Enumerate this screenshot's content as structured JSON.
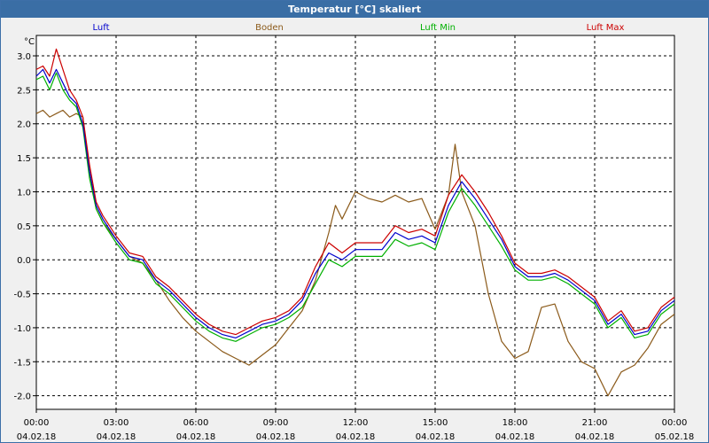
{
  "window": {
    "title": "Temperatur [°C] skaliert"
  },
  "chart_data": {
    "type": "line",
    "title": "Temperatur [°C] skaliert",
    "ylabel": "°C",
    "ylim": [
      -2.2,
      3.3
    ],
    "xlim": [
      "04.02.18 00:00",
      "05.02.18 00:00"
    ],
    "grid": true,
    "legend_position": "top",
    "colors": {
      "Luft": "#0000cc",
      "Boden": "#8b5a1a",
      "Luft Min": "#00b000",
      "Luft Max": "#cc0000"
    },
    "y_ticks": [
      "3.0",
      "2.5",
      "2.0",
      "1.5",
      "1.0",
      "0.5",
      "0.0",
      "-0.5",
      "-1.0",
      "-1.5",
      "-2.0"
    ],
    "y_tick_values": [
      3.0,
      2.5,
      2.0,
      1.5,
      1.0,
      0.5,
      0.0,
      -0.5,
      -1.0,
      -1.5,
      -2.0
    ],
    "x_ticks": [
      {
        "time": "00:00",
        "date": "04.02.18"
      },
      {
        "time": "03:00",
        "date": "04.02.18"
      },
      {
        "time": "06:00",
        "date": "04.02.18"
      },
      {
        "time": "09:00",
        "date": "04.02.18"
      },
      {
        "time": "12:00",
        "date": "04.02.18"
      },
      {
        "time": "15:00",
        "date": "04.02.18"
      },
      {
        "time": "18:00",
        "date": "04.02.18"
      },
      {
        "time": "21:00",
        "date": "04.02.18"
      },
      {
        "time": "00:00",
        "date": "05.02.18"
      }
    ],
    "x_tick_hours": [
      0,
      3,
      6,
      9,
      12,
      15,
      18,
      21,
      24
    ],
    "series": [
      {
        "name": "Luft",
        "x": [
          0,
          0.25,
          0.5,
          0.75,
          1.0,
          1.25,
          1.5,
          1.75,
          2.0,
          2.25,
          2.5,
          2.75,
          3.0,
          3.5,
          4.0,
          4.5,
          5.0,
          5.5,
          6.0,
          6.5,
          7.0,
          7.5,
          8.0,
          8.5,
          9.0,
          9.5,
          10.0,
          10.5,
          11.0,
          11.5,
          12.0,
          12.5,
          13.0,
          13.5,
          14.0,
          14.5,
          15.0,
          15.5,
          16.0,
          16.5,
          17.0,
          17.5,
          18.0,
          18.5,
          19.0,
          19.5,
          20.0,
          20.5,
          21.0,
          21.5,
          22.0,
          22.5,
          23.0,
          23.5,
          24.0
        ],
        "y": [
          2.7,
          2.8,
          2.6,
          2.8,
          2.6,
          2.4,
          2.3,
          2.0,
          1.3,
          0.8,
          0.6,
          0.45,
          0.3,
          0.05,
          0.0,
          -0.3,
          -0.45,
          -0.65,
          -0.85,
          -1.0,
          -1.1,
          -1.15,
          -1.05,
          -0.95,
          -0.9,
          -0.8,
          -0.6,
          -0.2,
          0.1,
          0.0,
          0.15,
          0.15,
          0.15,
          0.4,
          0.3,
          0.35,
          0.25,
          0.8,
          1.15,
          0.9,
          0.6,
          0.3,
          -0.1,
          -0.25,
          -0.25,
          -0.2,
          -0.3,
          -0.45,
          -0.6,
          -0.95,
          -0.8,
          -1.1,
          -1.05,
          -0.75,
          -0.6
        ]
      },
      {
        "name": "Boden",
        "x": [
          0,
          0.25,
          0.5,
          0.75,
          1.0,
          1.25,
          1.5,
          1.75,
          2.0,
          2.25,
          2.5,
          3.0,
          3.5,
          4.0,
          4.5,
          5.0,
          5.5,
          6.0,
          6.5,
          7.0,
          7.5,
          8.0,
          8.5,
          9.0,
          9.5,
          10.0,
          10.5,
          11.0,
          11.25,
          11.5,
          12.0,
          12.5,
          13.0,
          13.5,
          14.0,
          14.5,
          15.0,
          15.5,
          15.75,
          16.0,
          16.5,
          17.0,
          17.5,
          18.0,
          18.5,
          19.0,
          19.5,
          20.0,
          20.5,
          21.0,
          21.5,
          22.0,
          22.5,
          23.0,
          23.5,
          24.0
        ],
        "y": [
          2.15,
          2.2,
          2.1,
          2.15,
          2.2,
          2.1,
          2.15,
          2.1,
          1.3,
          0.75,
          0.55,
          0.3,
          0.05,
          -0.05,
          -0.3,
          -0.6,
          -0.85,
          -1.05,
          -1.2,
          -1.35,
          -1.45,
          -1.55,
          -1.4,
          -1.25,
          -1.0,
          -0.75,
          -0.3,
          0.4,
          0.8,
          0.6,
          1.0,
          0.9,
          0.85,
          0.95,
          0.85,
          0.9,
          0.45,
          0.95,
          1.7,
          1.0,
          0.5,
          -0.5,
          -1.2,
          -1.45,
          -1.35,
          -0.7,
          -0.65,
          -1.2,
          -1.5,
          -1.6,
          -2.0,
          -1.65,
          -1.55,
          -1.3,
          -0.95,
          -0.8
        ]
      },
      {
        "name": "Luft Min",
        "x": [
          0,
          0.25,
          0.5,
          0.75,
          1.0,
          1.25,
          1.5,
          1.75,
          2.0,
          2.25,
          2.5,
          2.75,
          3.0,
          3.5,
          4.0,
          4.5,
          5.0,
          5.5,
          6.0,
          6.5,
          7.0,
          7.5,
          8.0,
          8.5,
          9.0,
          9.5,
          10.0,
          10.5,
          11.0,
          11.5,
          12.0,
          12.5,
          13.0,
          13.5,
          14.0,
          14.5,
          15.0,
          15.5,
          16.0,
          16.5,
          17.0,
          17.5,
          18.0,
          18.5,
          19.0,
          19.5,
          20.0,
          20.5,
          21.0,
          21.5,
          22.0,
          22.5,
          23.0,
          23.5,
          24.0
        ],
        "y": [
          2.65,
          2.7,
          2.5,
          2.75,
          2.5,
          2.35,
          2.25,
          1.95,
          1.2,
          0.75,
          0.55,
          0.4,
          0.25,
          0.0,
          -0.05,
          -0.35,
          -0.5,
          -0.7,
          -0.9,
          -1.05,
          -1.15,
          -1.2,
          -1.1,
          -1.0,
          -0.95,
          -0.85,
          -0.7,
          -0.35,
          0.0,
          -0.1,
          0.05,
          0.05,
          0.05,
          0.3,
          0.2,
          0.25,
          0.15,
          0.7,
          1.05,
          0.8,
          0.5,
          0.2,
          -0.15,
          -0.3,
          -0.3,
          -0.25,
          -0.35,
          -0.5,
          -0.65,
          -1.0,
          -0.85,
          -1.15,
          -1.1,
          -0.8,
          -0.65
        ]
      },
      {
        "name": "Luft Max",
        "x": [
          0,
          0.25,
          0.5,
          0.75,
          1.0,
          1.25,
          1.5,
          1.75,
          2.0,
          2.25,
          2.5,
          2.75,
          3.0,
          3.5,
          4.0,
          4.5,
          5.0,
          5.5,
          6.0,
          6.5,
          7.0,
          7.5,
          8.0,
          8.5,
          9.0,
          9.5,
          10.0,
          10.5,
          11.0,
          11.5,
          12.0,
          12.5,
          13.0,
          13.5,
          14.0,
          14.5,
          15.0,
          15.5,
          16.0,
          16.5,
          17.0,
          17.5,
          18.0,
          18.5,
          19.0,
          19.5,
          20.0,
          20.5,
          21.0,
          21.5,
          22.0,
          22.5,
          23.0,
          23.5,
          24.0
        ],
        "y": [
          2.8,
          2.85,
          2.7,
          3.1,
          2.8,
          2.5,
          2.35,
          2.1,
          1.4,
          0.85,
          0.65,
          0.5,
          0.35,
          0.1,
          0.05,
          -0.25,
          -0.4,
          -0.6,
          -0.8,
          -0.95,
          -1.05,
          -1.1,
          -1.0,
          -0.9,
          -0.85,
          -0.75,
          -0.55,
          -0.1,
          0.25,
          0.1,
          0.25,
          0.25,
          0.25,
          0.5,
          0.4,
          0.45,
          0.35,
          0.95,
          1.25,
          1.0,
          0.7,
          0.35,
          -0.05,
          -0.2,
          -0.2,
          -0.15,
          -0.25,
          -0.4,
          -0.55,
          -0.9,
          -0.75,
          -1.05,
          -1.0,
          -0.7,
          -0.55
        ]
      }
    ]
  }
}
